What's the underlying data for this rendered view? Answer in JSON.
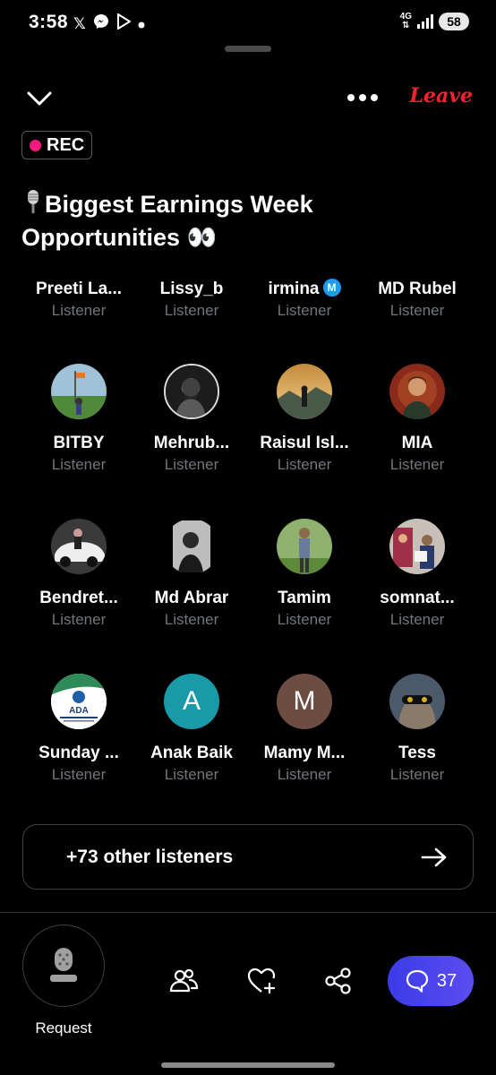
{
  "status_bar": {
    "time": "3:58",
    "left_icons": [
      "x-logo-icon",
      "messenger-icon",
      "play-store-icon",
      "dot-icon"
    ],
    "network": "4G",
    "battery": "58"
  },
  "header": {
    "leave_label": "Leave"
  },
  "rec_badge": {
    "label": "REC",
    "dot_color": "#f91880"
  },
  "space": {
    "title_line1": "Biggest Earnings Week",
    "title_line2": "Opportunities 👀"
  },
  "top_row": [
    {
      "name": "Preeti La...",
      "role": "Listener",
      "verified": false
    },
    {
      "name": "Lissy_b",
      "role": "Listener",
      "verified": false
    },
    {
      "name": "irmina",
      "role": "Listener",
      "verified": true
    },
    {
      "name": "MD Rubel",
      "role": "Listener",
      "verified": false
    }
  ],
  "rows": [
    [
      {
        "name": "BITBY",
        "role": "Listener",
        "avatar": "photo-outdoor"
      },
      {
        "name": "Mehrub...",
        "role": "Listener",
        "avatar": "photo-bw"
      },
      {
        "name": "Raisul Isl...",
        "role": "Listener",
        "avatar": "photo-sunset"
      },
      {
        "name": "MIA",
        "role": "Listener",
        "avatar": "photo-portrait"
      }
    ],
    [
      {
        "name": "Bendret...",
        "role": "Listener",
        "avatar": "photo-car"
      },
      {
        "name": "Md Abrar",
        "role": "Listener",
        "avatar": "photo-dark"
      },
      {
        "name": "Tamim",
        "role": "Listener",
        "avatar": "photo-field"
      },
      {
        "name": "somnat...",
        "role": "Listener",
        "avatar": "photo-group"
      }
    ],
    [
      {
        "name": "Sunday ...",
        "role": "Listener",
        "avatar": "logo-ada",
        "logo_text": "ADA"
      },
      {
        "name": "Anak Baik",
        "role": "Listener",
        "avatar": "letter",
        "letter": "A",
        "color": "#1a9aa8"
      },
      {
        "name": "Mamy M...",
        "role": "Listener",
        "avatar": "letter",
        "letter": "M",
        "color": "#6d4c41"
      },
      {
        "name": "Tess",
        "role": "Listener",
        "avatar": "photo-cat"
      }
    ]
  ],
  "others": {
    "label": "+73 other listeners"
  },
  "bottom_bar": {
    "request_label": "Request",
    "comment_count": "37",
    "accent_color": "#4a44ee"
  }
}
